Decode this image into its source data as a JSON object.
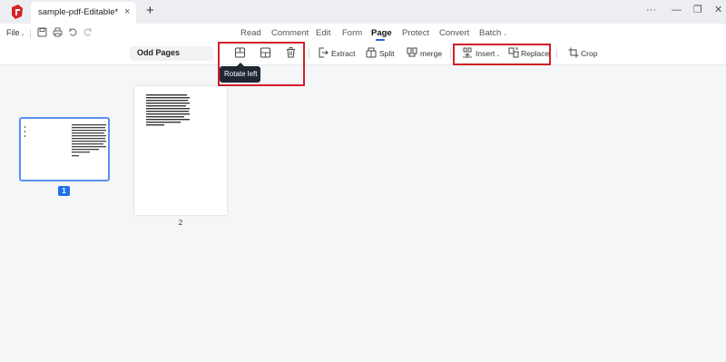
{
  "tabbar": {
    "tab_title": "sample-pdf-Editable*",
    "close_glyph": "×",
    "add_glyph": "+",
    "app_icon": "app-logo-icon",
    "window_controls": {
      "more": "···",
      "minimize": "—",
      "restore": "❐",
      "close": "✕"
    }
  },
  "menubar": {
    "file_label": "File",
    "file_chevron": "⌄",
    "quick_icons": [
      "save-icon",
      "print-icon",
      "undo-icon",
      "redo-icon"
    ],
    "nav": [
      "Read",
      "Comment",
      "Edit",
      "Form",
      "Page",
      "Protect",
      "Convert",
      "Batch"
    ],
    "active_nav": "Page",
    "batch_chevron": "⌄"
  },
  "toolbar": {
    "page_select_value": "Odd Pages",
    "icon_buttons": [
      "rotate-left-icon",
      "rotate-right-icon",
      "delete-page-icon"
    ],
    "extract_label": "Extract",
    "split_label": "Split",
    "merge_label": "merge",
    "insert_label": "Insert",
    "insert_chevron": "⌄",
    "replace_label": "Replace",
    "crop_label": "Crop",
    "tooltip": "Rotate left",
    "highlight_color": "#d0202a",
    "accent_color": "#2a5bd7"
  },
  "pages": {
    "page1_number": "1",
    "page2_number": "2",
    "selected_page": 1
  }
}
